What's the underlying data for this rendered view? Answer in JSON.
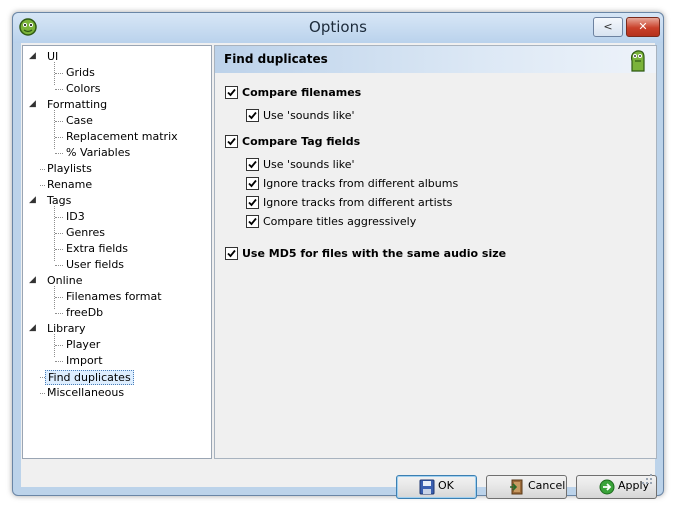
{
  "window": {
    "title": "Options",
    "help_button": "<",
    "close_button": "✕"
  },
  "tree": {
    "items": [
      {
        "label": "UI",
        "level": 0,
        "expanded": true
      },
      {
        "label": "Grids",
        "level": 1
      },
      {
        "label": "Colors",
        "level": 1
      },
      {
        "label": "Formatting",
        "level": 0,
        "expanded": true
      },
      {
        "label": "Case",
        "level": 1
      },
      {
        "label": "Replacement matrix",
        "level": 1
      },
      {
        "label": "% Variables",
        "level": 1
      },
      {
        "label": "Playlists",
        "level": 0
      },
      {
        "label": "Rename",
        "level": 0
      },
      {
        "label": "Tags",
        "level": 0,
        "expanded": true
      },
      {
        "label": "ID3",
        "level": 1
      },
      {
        "label": "Genres",
        "level": 1
      },
      {
        "label": "Extra fields",
        "level": 1
      },
      {
        "label": "User fields",
        "level": 1
      },
      {
        "label": "Online",
        "level": 0,
        "expanded": true
      },
      {
        "label": "Filenames format",
        "level": 1
      },
      {
        "label": "freeDb",
        "level": 1
      },
      {
        "label": "Library",
        "level": 0,
        "expanded": true
      },
      {
        "label": "Player",
        "level": 1
      },
      {
        "label": "Import",
        "level": 1
      },
      {
        "label": "Find duplicates",
        "level": 0,
        "selected": true
      },
      {
        "label": "Miscellaneous",
        "level": 0
      }
    ]
  },
  "panel": {
    "title": "Find duplicates",
    "options": {
      "compare_filenames": {
        "label": "Compare filenames",
        "checked": true
      },
      "filenames_sounds_like": {
        "label": "Use 'sounds like'",
        "checked": true
      },
      "compare_tag_fields": {
        "label": "Compare Tag fields",
        "checked": true
      },
      "tags_sounds_like": {
        "label": "Use 'sounds like'",
        "checked": true
      },
      "ignore_albums": {
        "label": "Ignore tracks from different albums",
        "checked": true
      },
      "ignore_artists": {
        "label": "Ignore tracks from different artists",
        "checked": true
      },
      "compare_titles": {
        "label": "Compare titles aggressively",
        "checked": true
      },
      "use_md5": {
        "label": "Use MD5 for files with the same audio size",
        "checked": true
      }
    }
  },
  "buttons": {
    "ok": "OK",
    "cancel": "Cancel",
    "apply": "Apply"
  },
  "colors": {
    "accent": "#3c7fb1",
    "title_bg": "#bcd3ea",
    "selection": "#ddeeff"
  }
}
